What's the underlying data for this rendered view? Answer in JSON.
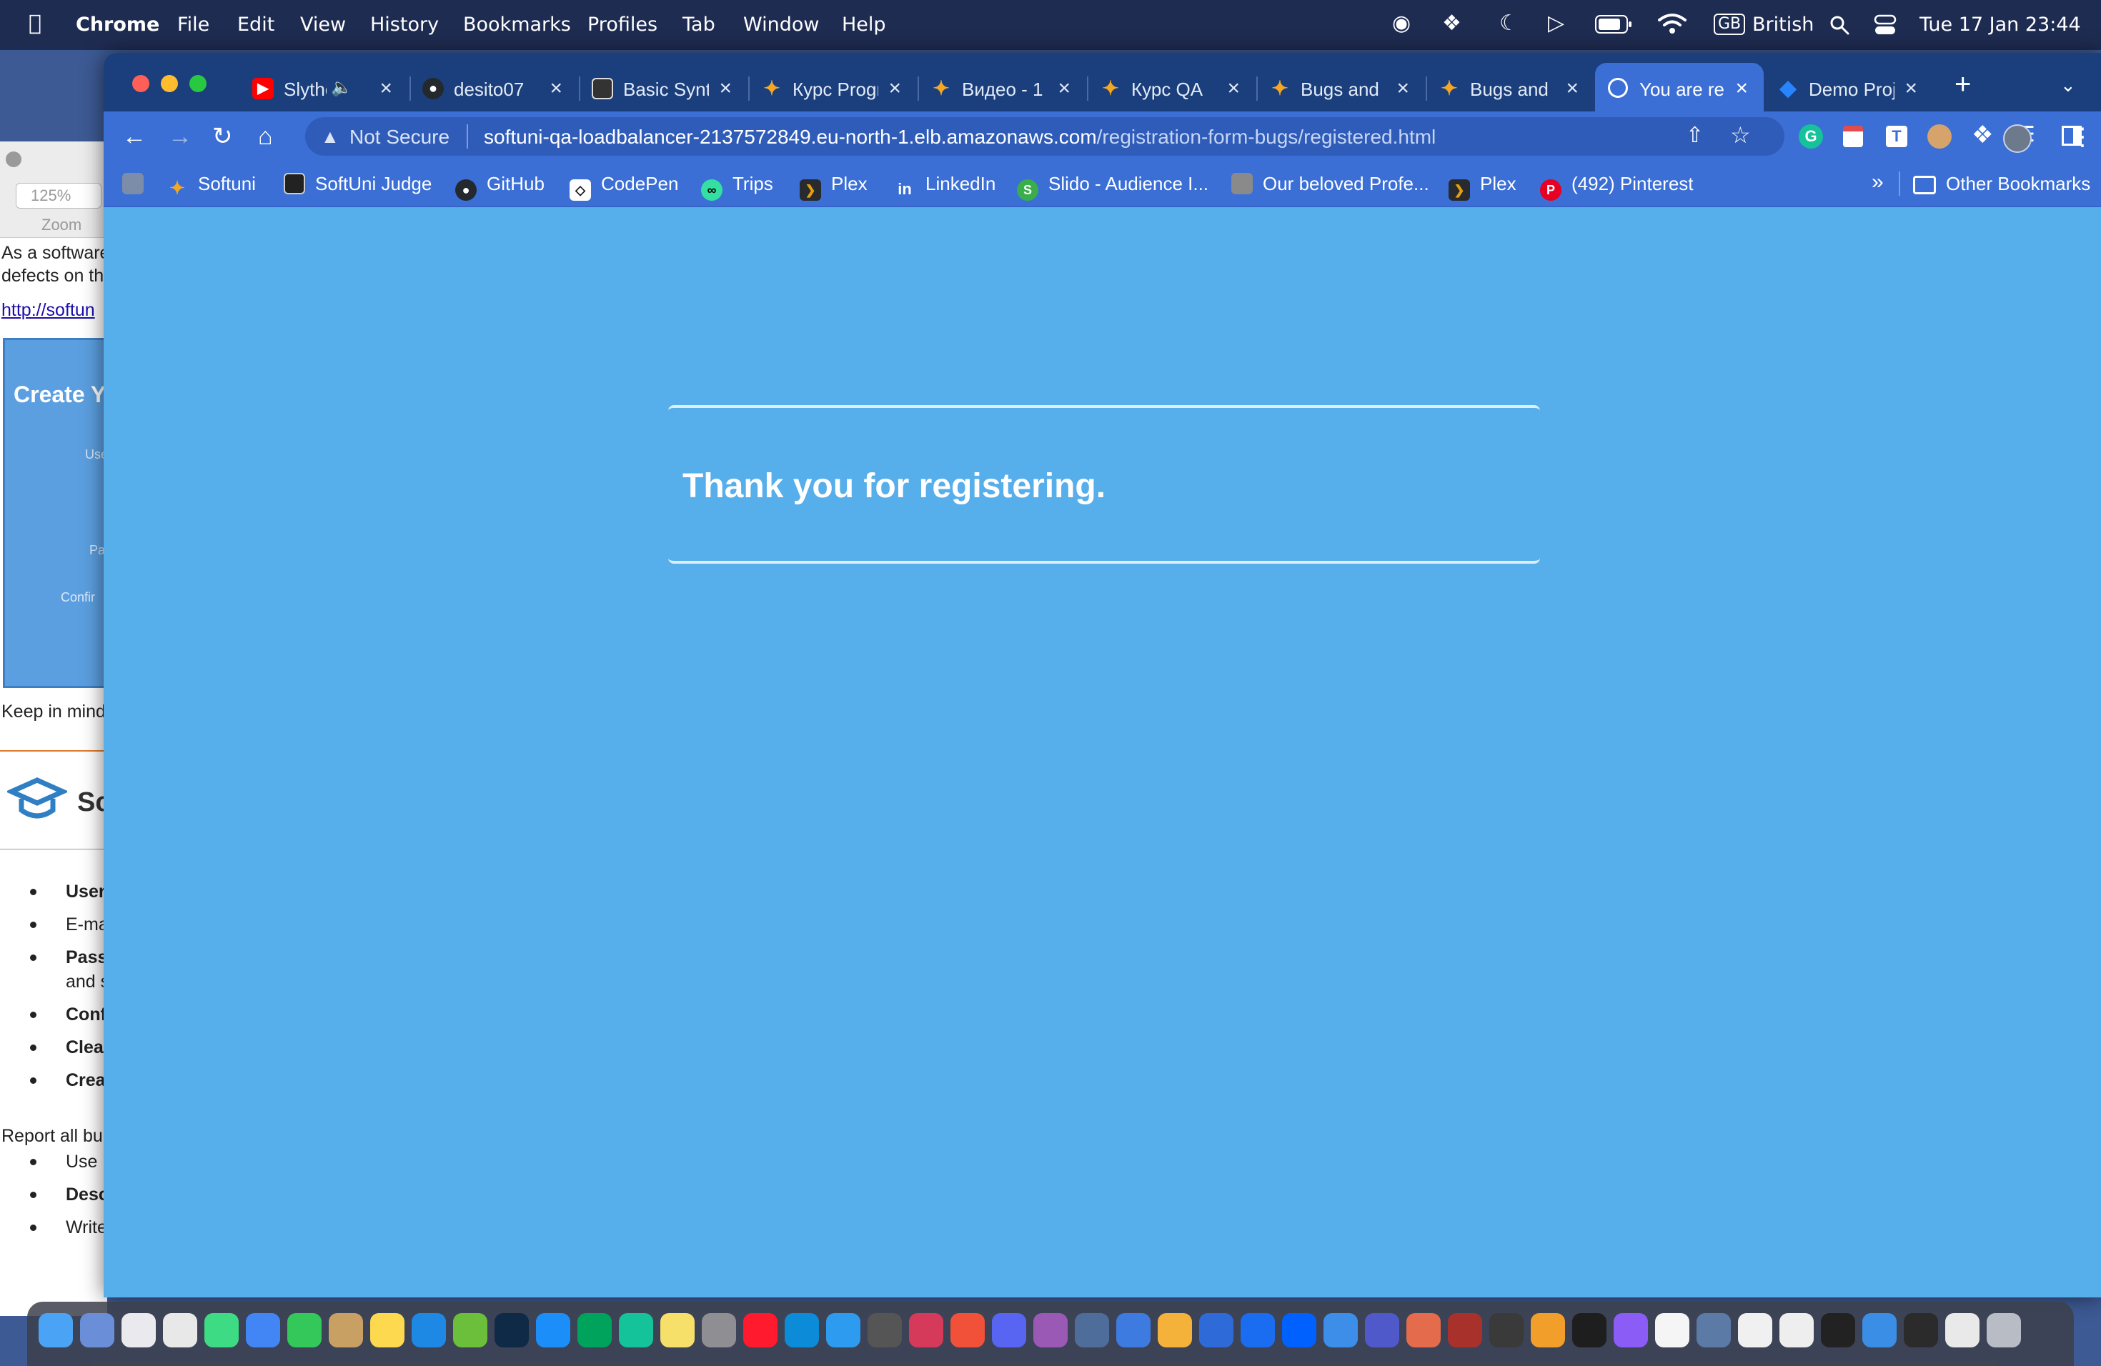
{
  "menubar": {
    "app_name": "Chrome",
    "menus": [
      "File",
      "Edit",
      "View",
      "History",
      "Bookmarks",
      "Profiles",
      "Tab",
      "Window",
      "Help"
    ],
    "keyboard_flag": "GB",
    "keyboard_layout": "British",
    "datetime": "Tue 17 Jan  23:44",
    "status_icons": [
      "password-icon",
      "dropbox-icon",
      "moon-icon",
      "play-icon",
      "battery-icon",
      "wifi-icon",
      "keyboard-icon",
      "search-icon",
      "control-center-icon"
    ]
  },
  "background_doc": {
    "zoom_value": "125%",
    "zoom_label": "Zoom",
    "lines": [
      "As a software",
      "defects on th",
      "http://softun",
      "Create Y",
      "Use",
      "Pa",
      "Confir",
      "Keep in mind",
      "Sc",
      "User",
      "E-ma",
      "Passv",
      "and s",
      "Conf",
      "Clear",
      "Crea",
      "Report all bu",
      "Use",
      "Desc",
      "Write the steps to reproduce the problem"
    ]
  },
  "browser": {
    "tabs": [
      {
        "label": "Slytherin",
        "icon": "youtube-icon",
        "color": "#ff0000"
      },
      {
        "label": "desito07",
        "icon": "github-icon",
        "color": "#24292e"
      },
      {
        "label": "Basic Syntax",
        "icon": "page-icon",
        "color": "#333333"
      },
      {
        "label": "Курс Programming",
        "icon": "softuni-icon",
        "color": "#f5a623"
      },
      {
        "label": "Видео - 1",
        "icon": "softuni-icon",
        "color": "#f5a623"
      },
      {
        "label": "Курс QA",
        "icon": "softuni-icon",
        "color": "#f5a623"
      },
      {
        "label": "Bugs and",
        "icon": "softuni-icon",
        "color": "#f5a623"
      },
      {
        "label": "Bugs and",
        "icon": "softuni-icon",
        "color": "#f5a623"
      },
      {
        "label": "You are registered",
        "icon": "globe-icon",
        "color": "#5aa0f0"
      },
      {
        "label": "Demo Project",
        "icon": "jira-icon",
        "color": "#2684ff"
      }
    ],
    "active_tab_index": 8,
    "security_label": "Not Secure",
    "url_host": "softuni-qa-loadbalancer-2137572849.eu-north-1.elb.amazonaws.com",
    "url_path": "/registration-form-bugs/registered.html",
    "bookmarks": [
      {
        "label": "Softuni",
        "icon": "softuni-icon",
        "color": "#f5a623"
      },
      {
        "label": "SoftUni Judge",
        "icon": "judge-icon",
        "color": "#222222"
      },
      {
        "label": "GitHub",
        "icon": "github-icon",
        "color": "#24292e"
      },
      {
        "label": "CodePen",
        "icon": "codepen-icon",
        "color": "#111111"
      },
      {
        "label": "Trips",
        "icon": "tripadvisor-icon",
        "color": "#34e0a1"
      },
      {
        "label": "Plex",
        "icon": "plex-icon",
        "color": "#282a2d"
      },
      {
        "label": "LinkedIn",
        "icon": "linkedin-icon",
        "color": "#0a66c2"
      },
      {
        "label": "Slido - Audience I...",
        "icon": "slido-icon",
        "color": "#3aae4b"
      },
      {
        "label": "Our beloved Profe...",
        "icon": "image-icon",
        "color": "#8a8a8a"
      },
      {
        "label": "Plex",
        "icon": "plex-icon",
        "color": "#282a2d"
      },
      {
        "label": "(492) Pinterest",
        "icon": "pinterest-icon",
        "color": "#e60023"
      }
    ],
    "more_bookmarks": "»",
    "other_bookmarks": "Other Bookmarks"
  },
  "page": {
    "heading": "Thank you for registering."
  },
  "dock": {
    "apps": [
      {
        "name": "finder",
        "color": "#4aa3f5"
      },
      {
        "name": "migration",
        "color": "#6a8fd8"
      },
      {
        "name": "launchpad",
        "color": "#e9e9ee"
      },
      {
        "name": "chrome",
        "color": "#e8e8e8"
      },
      {
        "name": "android-studio",
        "color": "#3ddc84"
      },
      {
        "name": "google-docs",
        "color": "#4285f4"
      },
      {
        "name": "messages",
        "color": "#34c759"
      },
      {
        "name": "keychain",
        "color": "#c9a063"
      },
      {
        "name": "notes",
        "color": "#fdd94f"
      },
      {
        "name": "vscode",
        "color": "#1e88e5"
      },
      {
        "name": "chameleon",
        "color": "#6bbf3a"
      },
      {
        "name": "mongo-compass",
        "color": "#0e2a47"
      },
      {
        "name": "app-store",
        "color": "#1c8ef9"
      },
      {
        "name": "mongodb",
        "color": "#00a35c"
      },
      {
        "name": "grammarly",
        "color": "#15c39a"
      },
      {
        "name": "stickies",
        "color": "#f7e06a"
      },
      {
        "name": "system-prefs",
        "color": "#8e8e93"
      },
      {
        "name": "opera",
        "color": "#ff1b2d"
      },
      {
        "name": "edge",
        "color": "#0c8cd8"
      },
      {
        "name": "safari",
        "color": "#2d9bf0"
      },
      {
        "name": "calculator",
        "color": "#555555"
      },
      {
        "name": "lips",
        "color": "#d63a5a"
      },
      {
        "name": "swift",
        "color": "#f05138"
      },
      {
        "name": "discord",
        "color": "#5865f2"
      },
      {
        "name": "affinity",
        "color": "#9b59b6"
      },
      {
        "name": "screens",
        "color": "#4f6d9a"
      },
      {
        "name": "mails",
        "color": "#3d7be0"
      },
      {
        "name": "cloud",
        "color": "#f4b23a"
      },
      {
        "name": "remote",
        "color": "#2e6bd8"
      },
      {
        "name": "1password",
        "color": "#1a6cf0"
      },
      {
        "name": "dropbox",
        "color": "#0061fe"
      },
      {
        "name": "visual-studio",
        "color": "#3c8ee8"
      },
      {
        "name": "teams",
        "color": "#5059c9"
      },
      {
        "name": "virtualbox",
        "color": "#e46b4c"
      },
      {
        "name": "dictionary",
        "color": "#a8322b"
      },
      {
        "name": "gpu",
        "color": "#3a3a3a"
      },
      {
        "name": "pages",
        "color": "#f29e2b"
      },
      {
        "name": "terminal",
        "color": "#1e1e1e"
      },
      {
        "name": "vs-mac",
        "color": "#8b5cf6"
      },
      {
        "name": "calendar",
        "color": "#f5f5f5"
      },
      {
        "name": "quicktime",
        "color": "#5b7aa6"
      },
      {
        "name": "script",
        "color": "#f0f0f0"
      },
      {
        "name": "preview",
        "color": "#eeeeee"
      },
      {
        "name": "opera-gx",
        "color": "#222222"
      },
      {
        "name": "start-here",
        "color": "#3a8ee6"
      },
      {
        "name": "screenshot",
        "color": "#2b2b2b"
      },
      {
        "name": "file",
        "color": "#e9e9e9"
      },
      {
        "name": "trash",
        "color": "#b8bcc4"
      }
    ]
  }
}
